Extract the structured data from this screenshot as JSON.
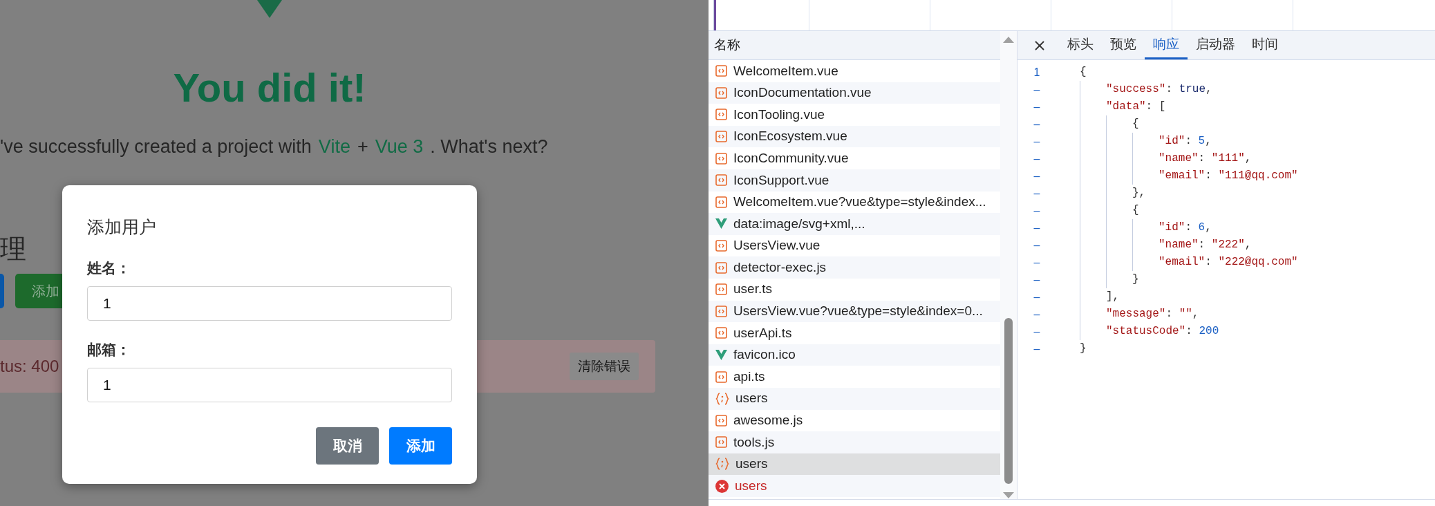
{
  "page": {
    "title": "You did it!",
    "subtitle": [
      {
        "kind": "text",
        "text": "'ve successfully created a project with"
      },
      {
        "kind": "link",
        "text": "Vite"
      },
      {
        "kind": "text",
        "text": "+"
      },
      {
        "kind": "link",
        "text": "Vue 3"
      },
      {
        "kind": "text",
        "text": ". What's next?"
      }
    ],
    "section_heading": "理",
    "action_buttons": [
      {
        "kind": "primary"
      },
      {
        "kind": "success",
        "label": "添加"
      }
    ],
    "error": {
      "message": "tus: 400",
      "button": "清除错误"
    }
  },
  "dialog": {
    "title": "添加用户",
    "fields": [
      {
        "label": "姓名：",
        "value": "1"
      },
      {
        "label": "邮箱：",
        "value": "1"
      }
    ],
    "buttons": [
      {
        "kind": "secondary",
        "label": "取消"
      },
      {
        "kind": "primary",
        "label": "添加"
      }
    ]
  },
  "devtools": {
    "list_header": "名称",
    "requests": [
      {
        "name": "WelcomeItem.vue",
        "kind": "script",
        "selected": false
      },
      {
        "name": "IconDocumentation.vue",
        "kind": "script",
        "selected": false
      },
      {
        "name": "IconTooling.vue",
        "kind": "script",
        "selected": false
      },
      {
        "name": "IconEcosystem.vue",
        "kind": "script",
        "selected": false
      },
      {
        "name": "IconCommunity.vue",
        "kind": "script",
        "selected": false
      },
      {
        "name": "IconSupport.vue",
        "kind": "script",
        "selected": false
      },
      {
        "name": "WelcomeItem.vue?vue&type=style&index...",
        "kind": "script",
        "selected": false
      },
      {
        "name": "data:image/svg+xml,...",
        "kind": "image",
        "selected": false
      },
      {
        "name": "UsersView.vue",
        "kind": "script",
        "selected": false
      },
      {
        "name": "detector-exec.js",
        "kind": "script",
        "selected": false
      },
      {
        "name": "user.ts",
        "kind": "script",
        "selected": false
      },
      {
        "name": "UsersView.vue?vue&type=style&index=0...",
        "kind": "script",
        "selected": false
      },
      {
        "name": "userApi.ts",
        "kind": "script",
        "selected": false
      },
      {
        "name": "favicon.ico",
        "kind": "image",
        "selected": false
      },
      {
        "name": "api.ts",
        "kind": "script",
        "selected": false
      },
      {
        "name": "users",
        "kind": "fetch",
        "selected": false
      },
      {
        "name": "awesome.js",
        "kind": "script",
        "selected": false
      },
      {
        "name": "tools.js",
        "kind": "script",
        "selected": false
      },
      {
        "name": "users",
        "kind": "fetch",
        "selected": true
      },
      {
        "name": "users",
        "kind": "error",
        "selected": false
      }
    ],
    "tabs": [
      {
        "label": "标头",
        "selected": false
      },
      {
        "label": "预览",
        "selected": false
      },
      {
        "label": "响应",
        "selected": true
      },
      {
        "label": "启动器",
        "selected": false
      },
      {
        "label": "时间",
        "selected": false
      }
    ],
    "response_lines": [
      {
        "gutter": "1",
        "tokens": [
          {
            "kind": "punct",
            "text": "{"
          }
        ],
        "children": [
          {
            "gutter": "–",
            "tokens": [
              {
                "kind": "key",
                "text": "\"success\""
              },
              {
                "kind": "punct",
                "text": ": "
              },
              {
                "kind": "keyword",
                "text": "true"
              },
              {
                "kind": "punct",
                "text": ","
              }
            ]
          },
          {
            "gutter": "–",
            "tokens": [
              {
                "kind": "key",
                "text": "\"data\""
              },
              {
                "kind": "punct",
                "text": ": ["
              }
            ],
            "children": [
              {
                "gutter": "–",
                "tokens": [
                  {
                    "kind": "punct",
                    "text": "{"
                  }
                ],
                "children": [
                  {
                    "gutter": "–",
                    "tokens": [
                      {
                        "kind": "key",
                        "text": "\"id\""
                      },
                      {
                        "kind": "punct",
                        "text": ": "
                      },
                      {
                        "kind": "number",
                        "text": "5"
                      },
                      {
                        "kind": "punct",
                        "text": ","
                      }
                    ]
                  },
                  {
                    "gutter": "–",
                    "tokens": [
                      {
                        "kind": "key",
                        "text": "\"name\""
                      },
                      {
                        "kind": "punct",
                        "text": ": "
                      },
                      {
                        "kind": "string",
                        "text": "\"111\""
                      },
                      {
                        "kind": "punct",
                        "text": ","
                      }
                    ]
                  },
                  {
                    "gutter": "–",
                    "tokens": [
                      {
                        "kind": "key",
                        "text": "\"email\""
                      },
                      {
                        "kind": "punct",
                        "text": ": "
                      },
                      {
                        "kind": "string",
                        "text": "\"111@qq.com\""
                      }
                    ]
                  }
                ]
              },
              {
                "gutter": "–",
                "tokens": [
                  {
                    "kind": "punct",
                    "text": "},"
                  }
                ]
              },
              {
                "gutter": "–",
                "tokens": [
                  {
                    "kind": "punct",
                    "text": "{"
                  }
                ],
                "children": [
                  {
                    "gutter": "–",
                    "tokens": [
                      {
                        "kind": "key",
                        "text": "\"id\""
                      },
                      {
                        "kind": "punct",
                        "text": ": "
                      },
                      {
                        "kind": "number",
                        "text": "6"
                      },
                      {
                        "kind": "punct",
                        "text": ","
                      }
                    ]
                  },
                  {
                    "gutter": "–",
                    "tokens": [
                      {
                        "kind": "key",
                        "text": "\"name\""
                      },
                      {
                        "kind": "punct",
                        "text": ": "
                      },
                      {
                        "kind": "string",
                        "text": "\"222\""
                      },
                      {
                        "kind": "punct",
                        "text": ","
                      }
                    ]
                  },
                  {
                    "gutter": "–",
                    "tokens": [
                      {
                        "kind": "key",
                        "text": "\"email\""
                      },
                      {
                        "kind": "punct",
                        "text": ": "
                      },
                      {
                        "kind": "string",
                        "text": "\"222@qq.com\""
                      }
                    ]
                  }
                ]
              },
              {
                "gutter": "–",
                "tokens": [
                  {
                    "kind": "punct",
                    "text": "}"
                  }
                ]
              }
            ]
          },
          {
            "gutter": "–",
            "tokens": [
              {
                "kind": "punct",
                "text": "],"
              }
            ]
          },
          {
            "gutter": "–",
            "tokens": [
              {
                "kind": "key",
                "text": "\"message\""
              },
              {
                "kind": "punct",
                "text": ": "
              },
              {
                "kind": "string",
                "text": "\"\""
              },
              {
                "kind": "punct",
                "text": ","
              }
            ]
          },
          {
            "gutter": "–",
            "tokens": [
              {
                "kind": "key",
                "text": "\"statusCode\""
              },
              {
                "kind": "punct",
                "text": ": "
              },
              {
                "kind": "number",
                "text": "200"
              }
            ]
          }
        ]
      },
      {
        "gutter": "–",
        "tokens": [
          {
            "kind": "punct",
            "text": "}"
          }
        ]
      }
    ]
  }
}
